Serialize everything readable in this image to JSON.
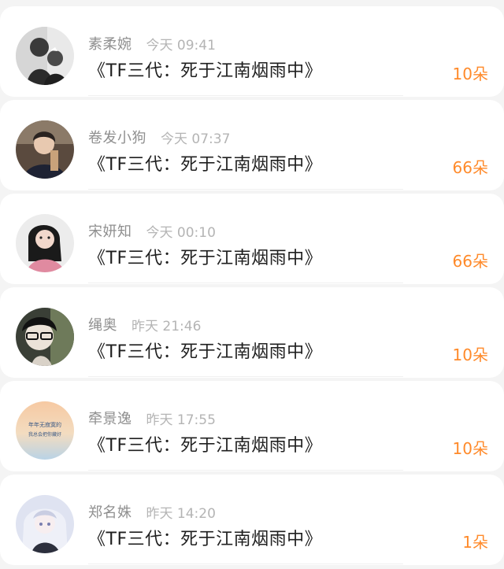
{
  "items": [
    {
      "name": "素柔婉",
      "time": "今天 09:41",
      "title": "《TF三代：死于江南烟雨中》",
      "count": "10朵",
      "avatar": "avatar-couple-bw"
    },
    {
      "name": "卷发小狗",
      "time": "今天 07:37",
      "title": "《TF三代：死于江南烟雨中》",
      "count": "66朵",
      "avatar": "avatar-boy-dark"
    },
    {
      "name": "宋妍知",
      "time": "今天 00:10",
      "title": "《TF三代：死于江南烟雨中》",
      "count": "66朵",
      "avatar": "avatar-girl-light"
    },
    {
      "name": "绳奥",
      "time": "昨天 21:46",
      "title": "《TF三代：死于江南烟雨中》",
      "count": "10朵",
      "avatar": "avatar-glasses-boy"
    },
    {
      "name": "牵景逸",
      "time": "昨天 17:55",
      "title": "《TF三代：死于江南烟雨中》",
      "count": "10朵",
      "avatar": "avatar-text-sunset",
      "avatar_text": [
        "年年无寂寞的",
        "我总会把你藏好"
      ]
    },
    {
      "name": "郑名姝",
      "time": "昨天 14:20",
      "title": "《TF三代：死于江南烟雨中》",
      "count": "1朵",
      "avatar": "avatar-anime-girl"
    }
  ],
  "colors": {
    "name": "#8f8f8f",
    "time": "#b4b4b4",
    "title": "#1f1f1f",
    "count": "#ff8a2a"
  }
}
